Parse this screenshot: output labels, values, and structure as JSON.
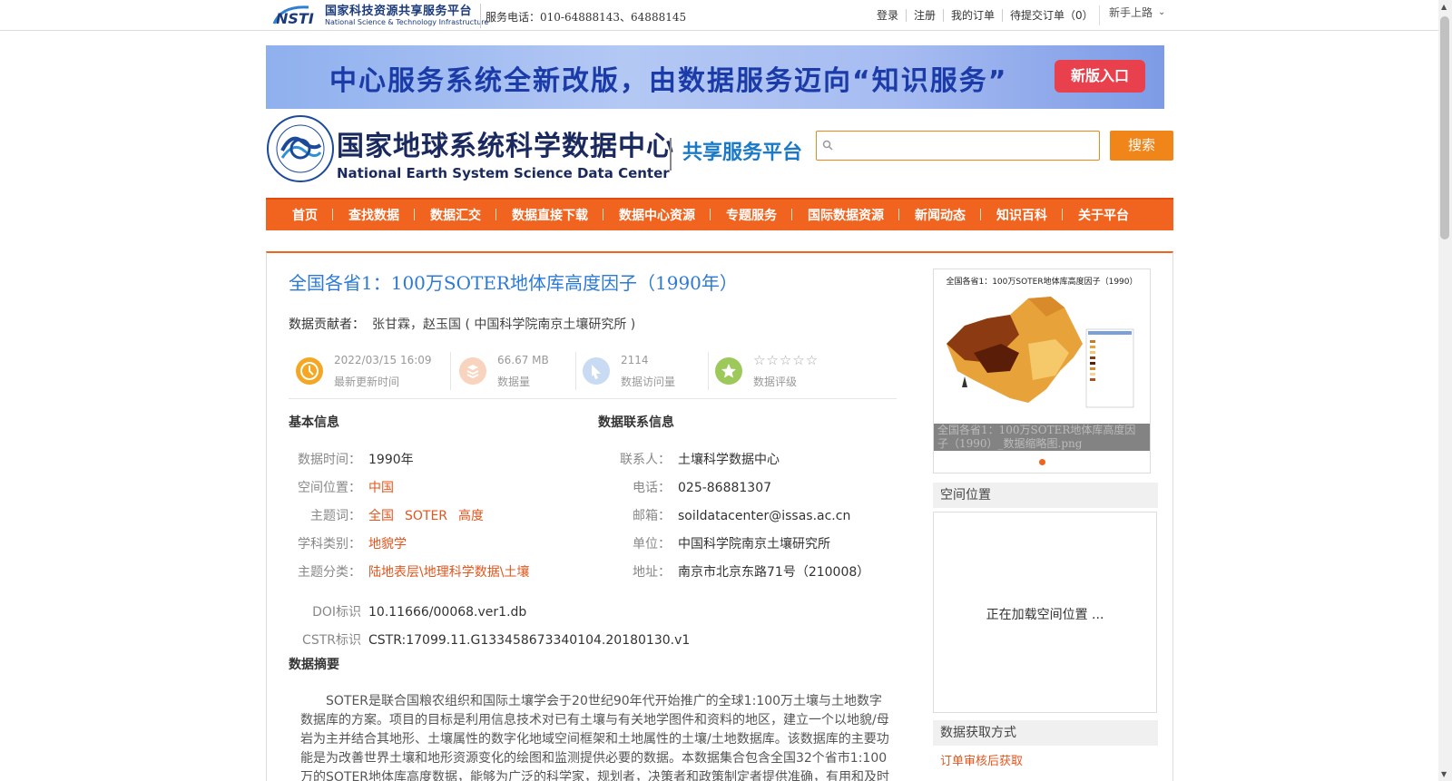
{
  "topbar": {
    "logo_cn": "国家科技资源共享服务平台",
    "logo_en": "National Science & Technology Infrastructure",
    "logo_mark": "NSTI",
    "phone": "服务电话：010-64888143、64888145",
    "links": [
      "登录",
      "注册",
      "我的订单",
      "待提交订单（0）"
    ],
    "guide": "新手上路"
  },
  "banner": {
    "text": "中心服务系统全新改版，由数据服务迈向“知识服务”",
    "button": "新版入口"
  },
  "header": {
    "name_cn": "国家地球系统科学数据中心",
    "name_en": "National Earth System Science Data Center",
    "platform": "共享服务平台",
    "search_placeholder": "",
    "search_button": "搜索"
  },
  "nav": [
    "首页",
    "查找数据",
    "数据汇交",
    "数据直接下载",
    "数据中心资源",
    "专题服务",
    "国际数据资源",
    "新闻动态",
    "知识百科",
    "关于平台"
  ],
  "dataset": {
    "title": "全国各省1：100万SOTER地体库高度因子（1990年）",
    "contributor_label": "数据贡献者：",
    "contributor": "张甘霖，赵玉国 ( 中国科学院南京土壤研究所 )",
    "stats": [
      {
        "value": "2022/03/15 16:09",
        "label": "最新更新时间",
        "color": "#f5a623"
      },
      {
        "value": "66.67 MB",
        "label": "数据量",
        "color": "#f8d3bd"
      },
      {
        "value": "2114",
        "label": "数据访问量",
        "color": "#c9dbf2"
      },
      {
        "value": "☆☆☆☆☆",
        "label": "数据评级",
        "color": "#9cc95a"
      }
    ]
  },
  "basic": {
    "title": "基本信息",
    "rows": [
      {
        "k": "数据时间：",
        "v": "1990年"
      },
      {
        "k": "空间位置：",
        "v": "中国"
      },
      {
        "k": "主题词：",
        "v": [
          "全国",
          "SOTER",
          "高度"
        ]
      },
      {
        "k": "学科类别：",
        "v": "地貌学"
      },
      {
        "k": "主题分类：",
        "v": "陆地表层\\地理科学数据\\土壤"
      }
    ],
    "doi_label": "DOI标识",
    "doi": "10.11666/00068.ver1.db",
    "cstr_label": "CSTR标识",
    "cstr": "CSTR:17099.11.G133458673340104.20180130.v1"
  },
  "contact": {
    "title": "数据联系信息",
    "rows": [
      {
        "k": "联系人：",
        "v": "土壤科学数据中心"
      },
      {
        "k": "电话：",
        "v": "025-86881307"
      },
      {
        "k": "邮箱：",
        "v": "soildatacenter@issas.ac.cn"
      },
      {
        "k": "单位：",
        "v": "中国科学院南京土壤研究所"
      },
      {
        "k": "地址：",
        "v": "南京市北京东路71号（210008）"
      }
    ]
  },
  "abstract": {
    "title": "数据摘要",
    "text": "SOTER是联合国粮农组织和国际土壤学会于20世纪90年代开始推广的全球1:100万土壤与土地数字数据库的方案。项目的目标是利用信息技术对已有土壤与有关地学图件和资料的地区，建立一个以地貌/母岩为主并结合其地形、土壤属性的数字化地域空间框架和土地属性的土壤/土地数据库。该数据库的主要功能是为改善世界土壤和地形资源变化的绘图和监测提供必要的数据。本数据集合包含全国32个省市1:100万的SOTER地体库高度数据，能够为广泛的科学家，规划者，决策者和政策制定者提供准确，有用和及时的信"
  },
  "sidebar": {
    "thumb_title": "全国各省1：100万SOTER地体库高度因子（1990）",
    "thumb_caption": "全国各省1：100万SOTER地体库高度因子（1990）_数据缩略图.png",
    "spatial_title": "空间位置",
    "loading": "正在加载空间位置 ...",
    "access_title": "数据获取方式",
    "access_value": "订单审核后获取"
  }
}
